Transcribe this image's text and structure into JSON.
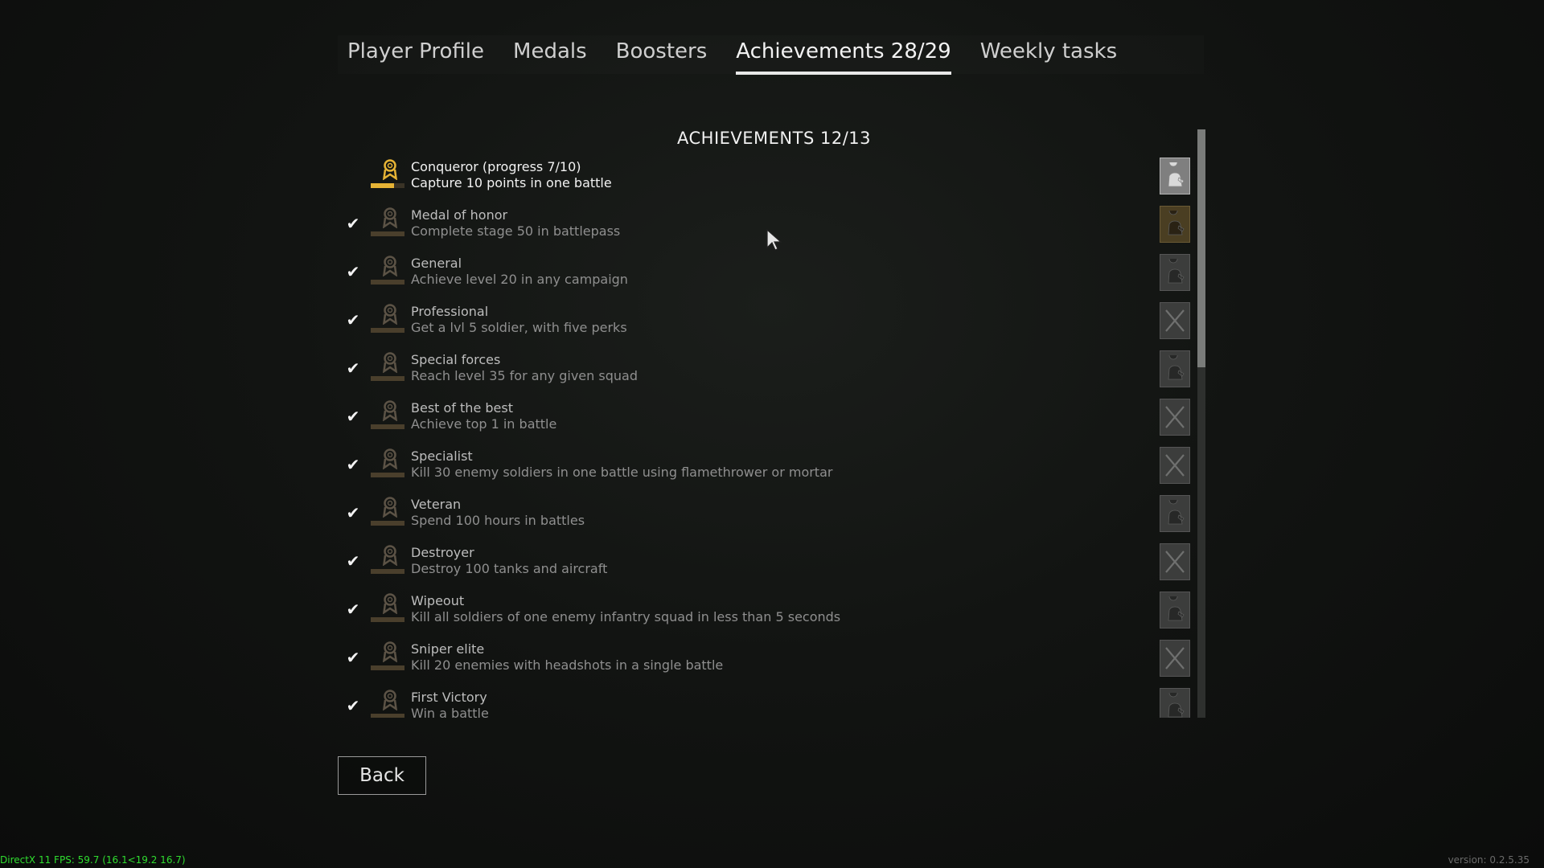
{
  "tabs": [
    {
      "label": "Player Profile",
      "active": false
    },
    {
      "label": "Medals",
      "active": false
    },
    {
      "label": "Boosters",
      "active": false
    },
    {
      "label": "Achievements 28/29",
      "active": true
    },
    {
      "label": "Weekly tasks",
      "active": false
    }
  ],
  "section_title": "ACHIEVEMENTS 12/13",
  "achievements": [
    {
      "title": "Conqueror (progress 7/10)",
      "desc": "Capture 10 points in one battle",
      "done": false,
      "progress": 0.7,
      "reward_icon": "soldier-icon"
    },
    {
      "title": "Medal of honor",
      "desc": "Complete stage 50 in battlepass",
      "done": true,
      "progress": 1,
      "reward_icon": "soldier-gold-icon"
    },
    {
      "title": "General",
      "desc": "Achieve level 20 in any campaign",
      "done": true,
      "progress": 1,
      "reward_icon": "soldier-icon"
    },
    {
      "title": "Professional",
      "desc": "Get a lvl 5 soldier, with five perks",
      "done": true,
      "progress": 1,
      "reward_icon": "crossed-swords-icon"
    },
    {
      "title": "Special forces",
      "desc": "Reach level 35 for any given squad",
      "done": true,
      "progress": 1,
      "reward_icon": "soldier-icon"
    },
    {
      "title": "Best of the best",
      "desc": "Achieve top 1 in battle",
      "done": true,
      "progress": 1,
      "reward_icon": "crossed-swords-icon"
    },
    {
      "title": "Specialist",
      "desc": "Kill 30 enemy soldiers in one battle using flamethrower or mortar",
      "done": true,
      "progress": 1,
      "reward_icon": "crossed-swords-icon"
    },
    {
      "title": "Veteran",
      "desc": "Spend 100 hours in battles",
      "done": true,
      "progress": 1,
      "reward_icon": "soldier-icon"
    },
    {
      "title": "Destroyer",
      "desc": "Destroy 100 tanks and aircraft",
      "done": true,
      "progress": 1,
      "reward_icon": "crossed-swords-icon"
    },
    {
      "title": "Wipeout",
      "desc": "Kill all soldiers of one enemy infantry squad in less than 5 seconds",
      "done": true,
      "progress": 1,
      "reward_icon": "soldier-icon"
    },
    {
      "title": "Sniper elite",
      "desc": "Kill 20 enemies with headshots in a single battle",
      "done": true,
      "progress": 1,
      "reward_icon": "crossed-swords-icon"
    },
    {
      "title": "First Victory",
      "desc": "Win a battle",
      "done": true,
      "progress": 1,
      "reward_icon": "soldier-icon"
    }
  ],
  "scroll_position": 0,
  "back_label": "Back",
  "fps_text": "DirectX 11 FPS: 59.7 (16.1<19.2 16.7)",
  "version_text": "version: 0.2.5.35",
  "colors": {
    "accent_gold": "#e6b335",
    "check": "#f2f2f2",
    "fps_green": "#2fdc2f"
  }
}
